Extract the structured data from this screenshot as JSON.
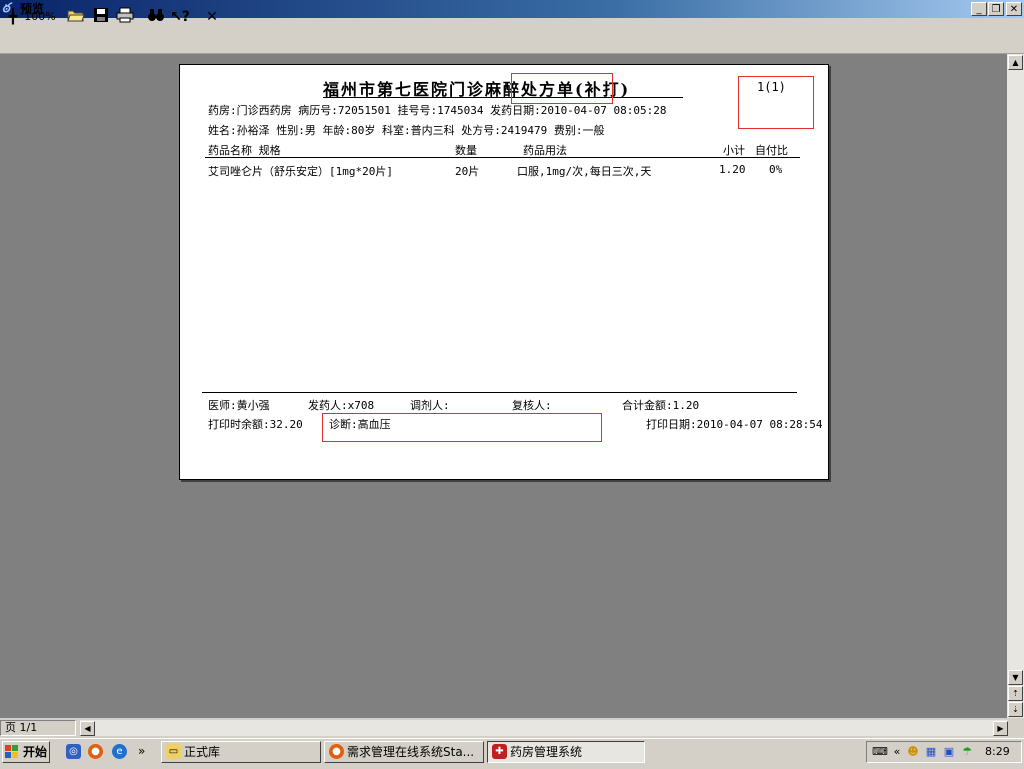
{
  "window": {
    "title": "预览",
    "app_icon": "preview-app-icon"
  },
  "window_buttons": {
    "minimize": "_",
    "restore": "❐",
    "close": "✕"
  },
  "toolbar": {
    "zoom_label": "100%"
  },
  "document": {
    "title": "福州市第七医院门诊麻醉处方单(补打)",
    "page_indicator": "1(1)",
    "line1": "药房:门诊西药房 病历号:72051501   挂号号:1745034 发药日期:2010-04-07 08:05:28",
    "line2": "姓名:孙裕泽      性别:男 年龄:80岁 科室:普内三科  处方号:2419479 费别:一般",
    "headers": {
      "name_spec": "药品名称 规格",
      "qty": "数量",
      "usage": "药品用法",
      "subtotal": "小计",
      "selfpay": "自付比"
    },
    "rows": [
      {
        "name_spec": "艾司唑仑片（舒乐安定）[1mg*20片]",
        "qty": "20片",
        "usage": "口服,1mg/次,每日三次,天",
        "subtotal": "1.20",
        "selfpay": "0%"
      }
    ],
    "footer": {
      "doctor": "医师:黄小强",
      "dispenser": "发药人:x708",
      "preparer": "调剂人:",
      "reviewer": "复核人:",
      "total": "合计金额:1.20",
      "balance": "打印时余额:32.20",
      "diagnosis": "诊断:高血压",
      "print_date": "打印日期:2010-04-07 08:28:54"
    }
  },
  "statusbar": {
    "page": "页 1/1"
  },
  "taskbar": {
    "start_label": "开始",
    "more": "»",
    "tasks": [
      {
        "label": "正式库",
        "active": false
      },
      {
        "label": "需求管理在线系统Sta...",
        "active": false
      },
      {
        "label": "药房管理系统",
        "active": true
      }
    ],
    "tray_more": "«",
    "clock": "8:29"
  }
}
